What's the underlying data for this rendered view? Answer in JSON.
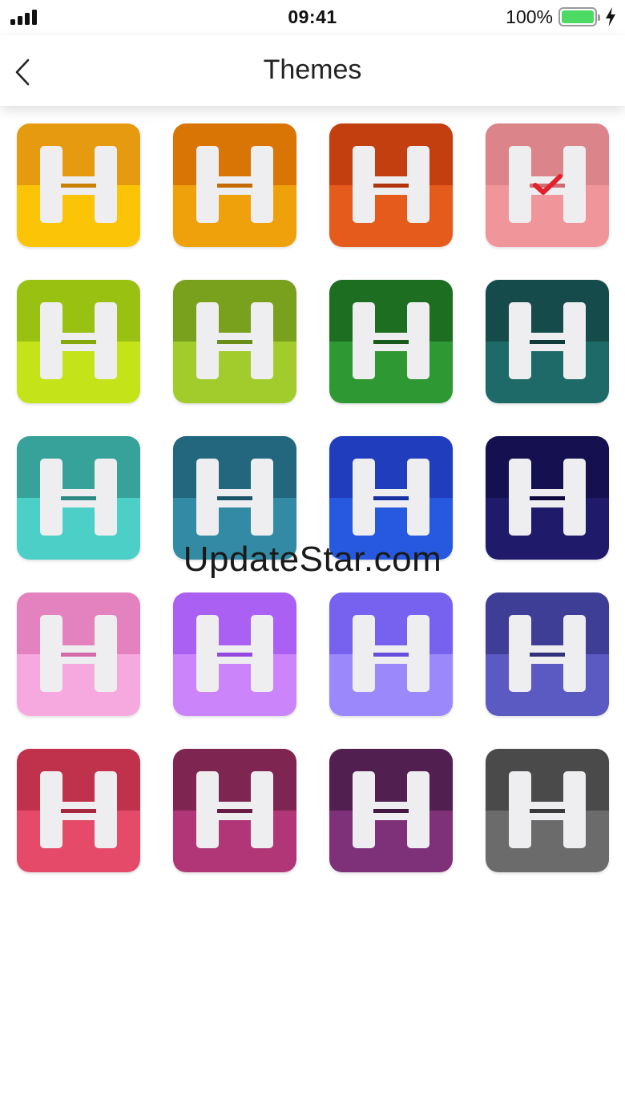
{
  "status_bar": {
    "time": "09:41",
    "battery_percent": "100%",
    "signal_bars": 4,
    "charging": true
  },
  "nav": {
    "title": "Themes",
    "back_icon": "chevron-left-icon"
  },
  "themes": {
    "selected_index": 3,
    "items": [
      {
        "id": "amber",
        "top": "#e69a10",
        "bottom": "#fcc406",
        "bar": "#c98004"
      },
      {
        "id": "orange",
        "top": "#d87504",
        "bottom": "#eea10b",
        "bar": "#c36a05"
      },
      {
        "id": "red-orange",
        "top": "#c33f10",
        "bottom": "#e55b1c",
        "bar": "#b0350d"
      },
      {
        "id": "salmon",
        "top": "#db8489",
        "bottom": "#f0969b",
        "bar": "#d26b72"
      },
      {
        "id": "yellow-green",
        "top": "#99c112",
        "bottom": "#c4e319",
        "bar": "#85aa0e"
      },
      {
        "id": "olive",
        "top": "#7aa11d",
        "bottom": "#a2cc2b",
        "bar": "#6a8c18"
      },
      {
        "id": "green",
        "top": "#1e6e22",
        "bottom": "#2e9832",
        "bar": "#175a1a"
      },
      {
        "id": "teal-dark",
        "top": "#154c4b",
        "bottom": "#1e6a69",
        "bar": "#0f3c3b"
      },
      {
        "id": "turquoise",
        "top": "#37a29a",
        "bottom": "#4bcfc6",
        "bar": "#2c8a83"
      },
      {
        "id": "steel-blue",
        "top": "#23677e",
        "bottom": "#338aa5",
        "bar": "#1b5466"
      },
      {
        "id": "royal-blue",
        "top": "#1f3dbd",
        "bottom": "#2759e0",
        "bar": "#1731a3"
      },
      {
        "id": "navy",
        "top": "#15104f",
        "bottom": "#201a6b",
        "bar": "#0f0b3f"
      },
      {
        "id": "pink",
        "top": "#e482bf",
        "bottom": "#f5a9df",
        "bar": "#d46bab"
      },
      {
        "id": "violet",
        "top": "#aa60f2",
        "bottom": "#cc84fb",
        "bar": "#9548e0"
      },
      {
        "id": "lavender",
        "top": "#7762ef",
        "bottom": "#9b88fb",
        "bar": "#6550de"
      },
      {
        "id": "indigo",
        "top": "#3f3e96",
        "bottom": "#5b5ac3",
        "bar": "#32317c"
      },
      {
        "id": "crimson",
        "top": "#c0314c",
        "bottom": "#e54b69",
        "bar": "#a8283f"
      },
      {
        "id": "magenta-dark",
        "top": "#7f2552",
        "bottom": "#b13677",
        "bar": "#6a1d44"
      },
      {
        "id": "plum",
        "top": "#522050",
        "bottom": "#7e3079",
        "bar": "#431943"
      },
      {
        "id": "gray",
        "top": "#4a4a4a",
        "bottom": "#6b6b6b",
        "bar": "#3a3a3a"
      }
    ]
  },
  "watermark": "UpdateStar.com"
}
